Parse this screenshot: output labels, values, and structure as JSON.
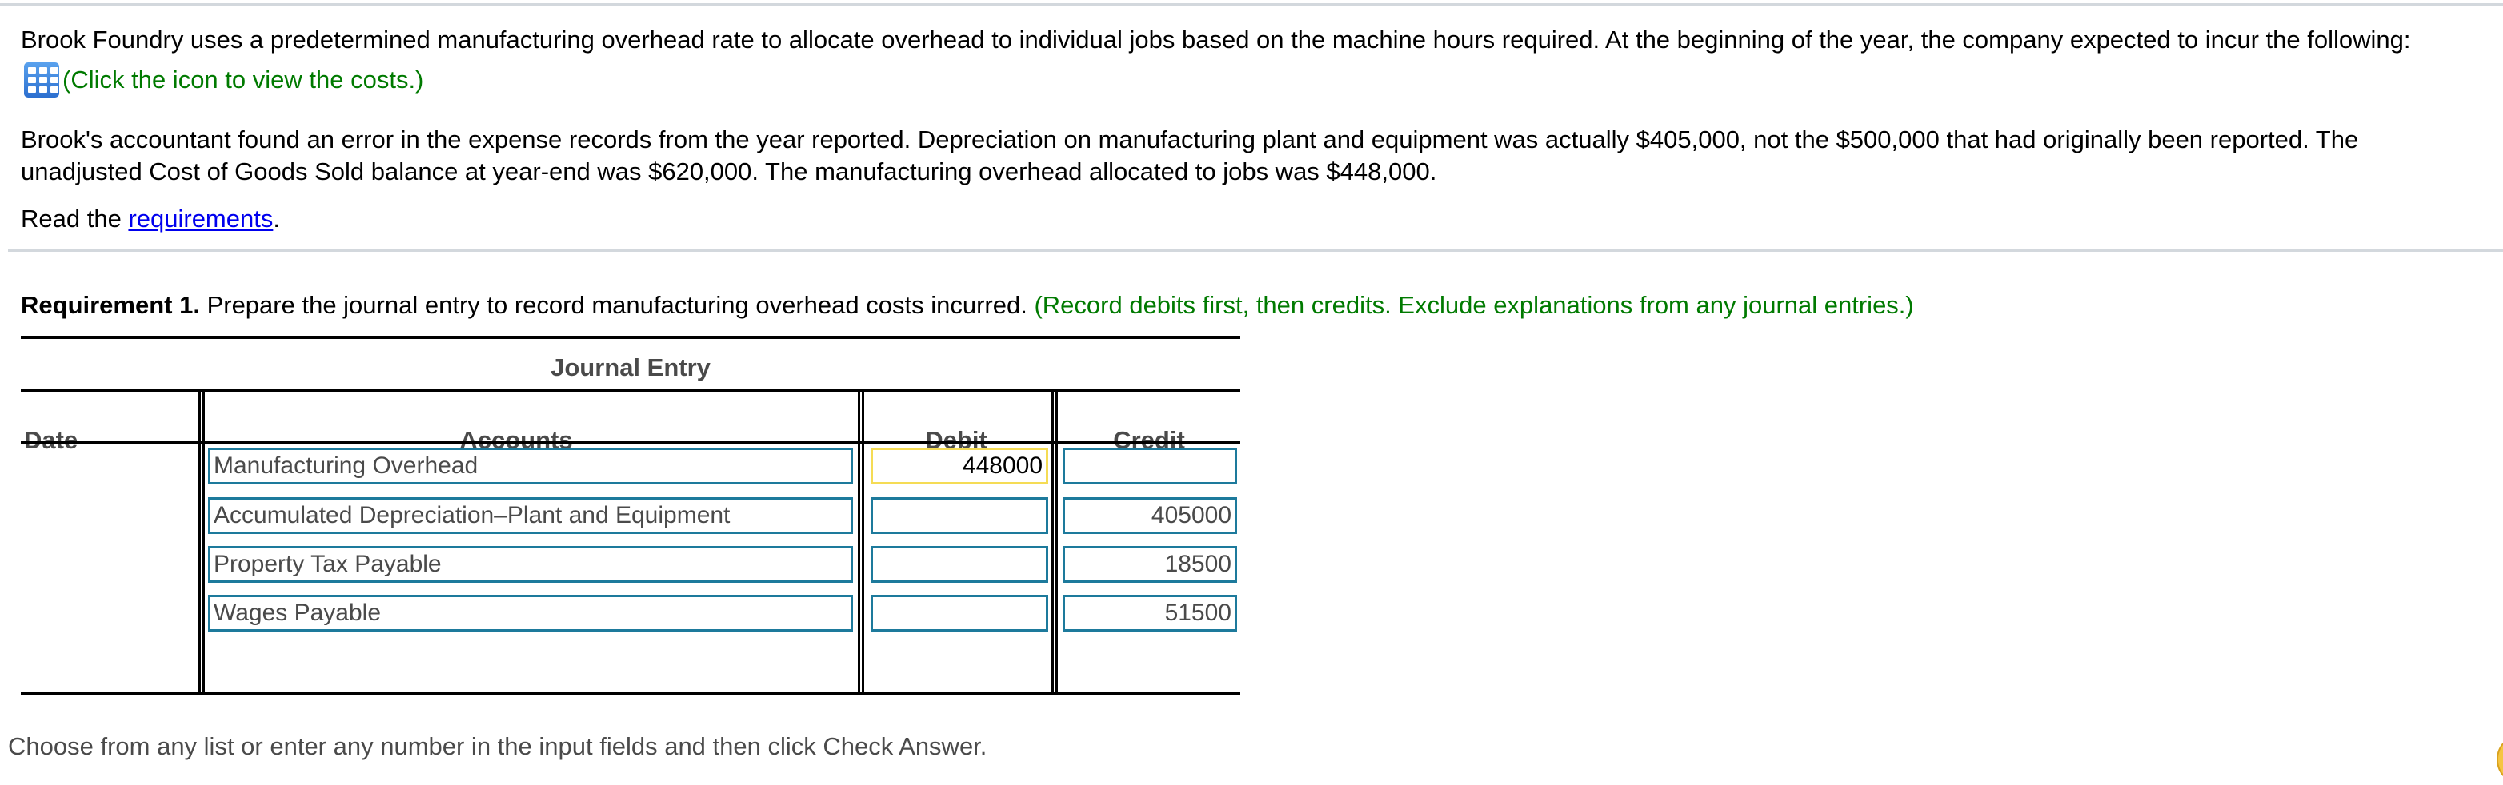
{
  "intro": {
    "paragraph1": "Brook Foundry uses a predetermined manufacturing overhead rate to allocate overhead to individual jobs based on the machine hours required. At the beginning of the year, the company expected to incur the following:",
    "costs_icon": "table-grid-icon",
    "costs_link": "(Click the icon to view the costs.)",
    "paragraph2": "Brook's accountant found an error in the expense records from the year reported. Depreciation on manufacturing plant and equipment was actually $405,000, not the $500,000 that had originally been reported. The unadjusted Cost of Goods Sold balance at year-end was $620,000. The manufacturing overhead allocated to jobs was $448,000.",
    "read_prefix": "Read the ",
    "requirements_link": "requirements",
    "read_suffix": "."
  },
  "requirement": {
    "label": "Requirement 1.",
    "text": " Prepare the journal entry to record manufacturing overhead costs incurred. ",
    "instruction": "(Record debits first, then credits. Exclude explanations from any journal entries.)"
  },
  "journal": {
    "title": "Journal Entry",
    "headers": {
      "date": "Date",
      "accounts": "Accounts",
      "debit": "Debit",
      "credit": "Credit"
    },
    "rows": [
      {
        "account": "Manufacturing Overhead",
        "debit": "448000",
        "credit": ""
      },
      {
        "account": "Accumulated Depreciation–Plant and Equipment",
        "debit": "",
        "credit": "405000"
      },
      {
        "account": "Property Tax Payable",
        "debit": "",
        "credit": "18500"
      },
      {
        "account": "Wages Payable",
        "debit": "",
        "credit": "51500"
      }
    ]
  },
  "footer": {
    "hint": "Choose from any list or enter any number in the input fields and then click Check Answer."
  },
  "colors": {
    "green_instruction": "#007a00",
    "link_blue": "#0000ee",
    "input_border": "#1d7a9c",
    "focus_border": "#f5dc55"
  }
}
